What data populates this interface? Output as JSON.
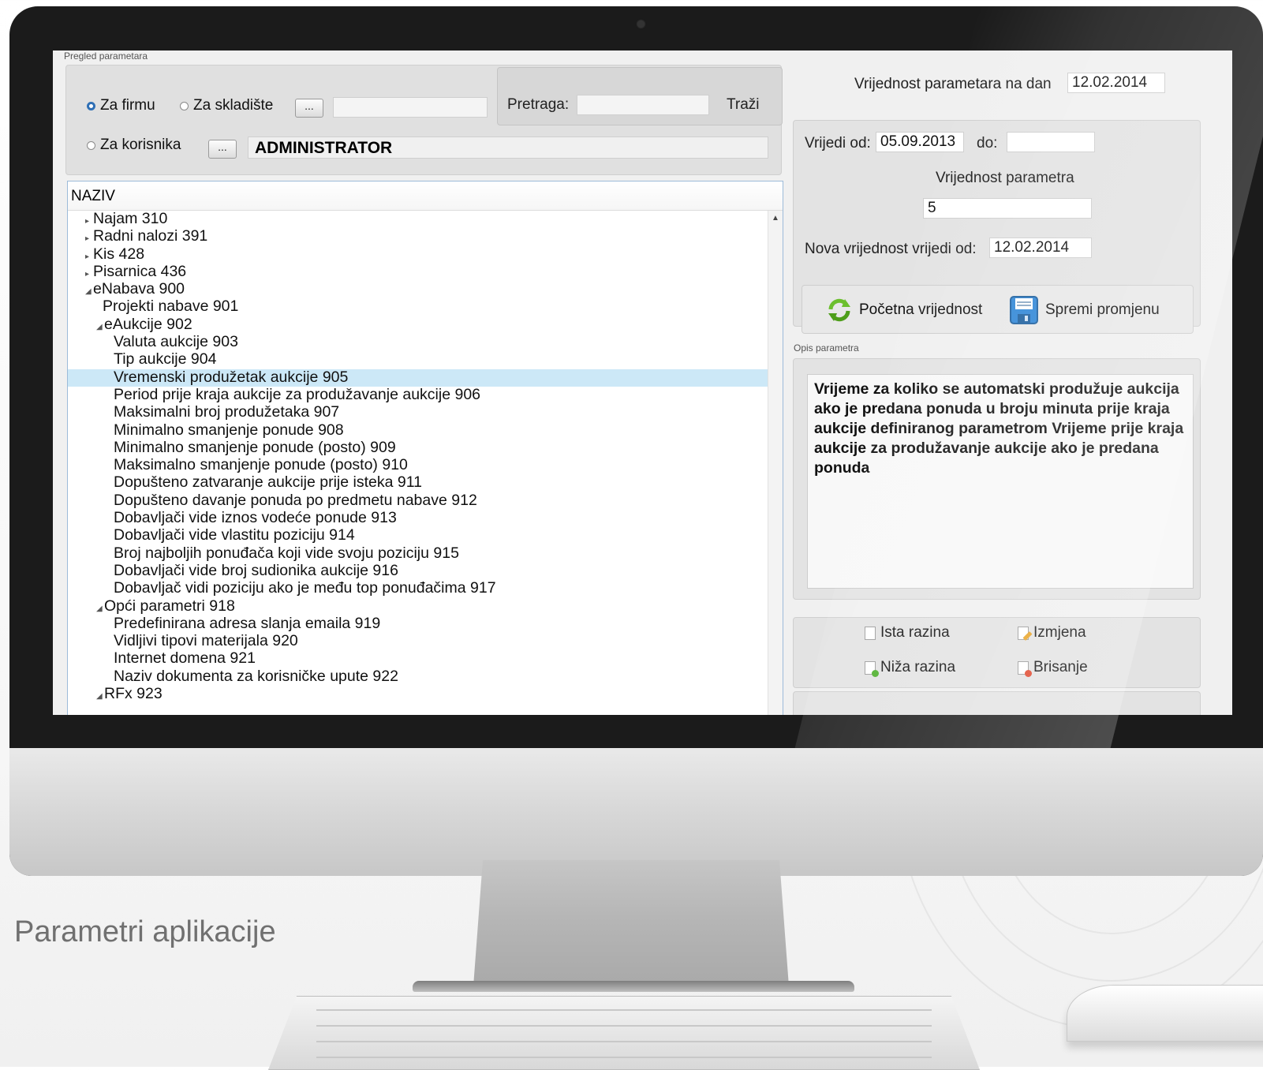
{
  "caption": "Parametri aplikacije",
  "colors": {
    "accent": "#2f6fb5",
    "selection": "#cce8f7",
    "bezel": "#1b1b1b"
  },
  "left_panel": {
    "group_caption": "Pregled parametara",
    "radio_firm": "Za firmu",
    "radio_warehouse": "Za skladište",
    "radio_user": "Za korisnika",
    "browse_label": "...",
    "search_label": "Pretraga:",
    "search_value": "",
    "search_button": "Traži",
    "user_value": "ADMINISTRATOR",
    "selected_scope": "Za firmu"
  },
  "tree": {
    "header": "NAZIV",
    "rows": [
      {
        "label": "Najam 310",
        "arrow": "▸"
      },
      {
        "label": "Radni nalozi 391",
        "arrow": "▸"
      },
      {
        "label": "Kis 428",
        "arrow": "▸"
      },
      {
        "label": "Pisarnica 436",
        "arrow": "▸"
      },
      {
        "label": "eNabava 900",
        "arrow": "◢"
      },
      {
        "label": "Projekti nabave 901",
        "arrow": ""
      },
      {
        "label": "eAukcije 902",
        "arrow": "◢"
      },
      {
        "label": "Valuta aukcije 903",
        "arrow": ""
      },
      {
        "label": "Tip aukcije 904",
        "arrow": ""
      },
      {
        "label": "Vremenski produžetak aukcije 905",
        "arrow": "",
        "selected": true
      },
      {
        "label": "Period prije kraja aukcije za produžavanje aukcije 906",
        "arrow": ""
      },
      {
        "label": "Maksimalni broj produžetaka 907",
        "arrow": ""
      },
      {
        "label": "Minimalno smanjenje ponude 908",
        "arrow": ""
      },
      {
        "label": "Minimalno smanjenje ponude (posto) 909",
        "arrow": ""
      },
      {
        "label": "Maksimalno smanjenje ponude (posto) 910",
        "arrow": ""
      },
      {
        "label": "Dopušteno zatvaranje aukcije prije isteka 911",
        "arrow": ""
      },
      {
        "label": "Dopušteno davanje ponuda po predmetu nabave 912",
        "arrow": ""
      },
      {
        "label": "Dobavljači vide iznos vodeće ponude 913",
        "arrow": ""
      },
      {
        "label": "Dobavljači vide vlastitu poziciju 914",
        "arrow": ""
      },
      {
        "label": "Broj najboljih ponuđača koji vide svoju poziciju 915",
        "arrow": ""
      },
      {
        "label": "Dobavljači vide broj sudionika aukcije 916",
        "arrow": ""
      },
      {
        "label": "Dobavljač vidi poziciju ako je među top ponuđačima 917",
        "arrow": ""
      },
      {
        "label": "Opći parametri 918",
        "arrow": "◢"
      },
      {
        "label": "Predefinirana adresa slanja emaila 919",
        "arrow": ""
      },
      {
        "label": "Vidljivi tipovi materijala 920",
        "arrow": ""
      },
      {
        "label": "Internet domena 921",
        "arrow": ""
      },
      {
        "label": "Naziv dokumenta za korisničke upute 922",
        "arrow": ""
      },
      {
        "label": "RFx 923",
        "arrow": "◢"
      }
    ]
  },
  "right_panel": {
    "value_on_date_label": "Vrijednost parametara na dan",
    "value_on_date": "12.02.2014",
    "valid_from_label": "Vrijedi od:",
    "valid_from": "05.09.2013",
    "valid_to_label": "do:",
    "valid_to": "",
    "param_value_label": "Vrijednost parametra",
    "param_value": "5",
    "new_value_from_label": "Nova vrijednost vrijedi od:",
    "new_value_from": "12.02.2014",
    "reset_button": "Početna vrijednost",
    "save_button": "Spremi promjenu",
    "description_caption": "Opis parametra",
    "description": "Vrijeme za koliko se automatski produžuje aukcija ako je predana ponuda u broju minuta prije kraja aukcije definiranog parametrom Vrijeme prije kraja aukcije za produžavanje aukcije ako je predana ponuda",
    "same_level_button": "Ista razina",
    "edit_button": "Izmjena",
    "lower_level_button": "Niža razina",
    "delete_button": "Brisanje"
  }
}
